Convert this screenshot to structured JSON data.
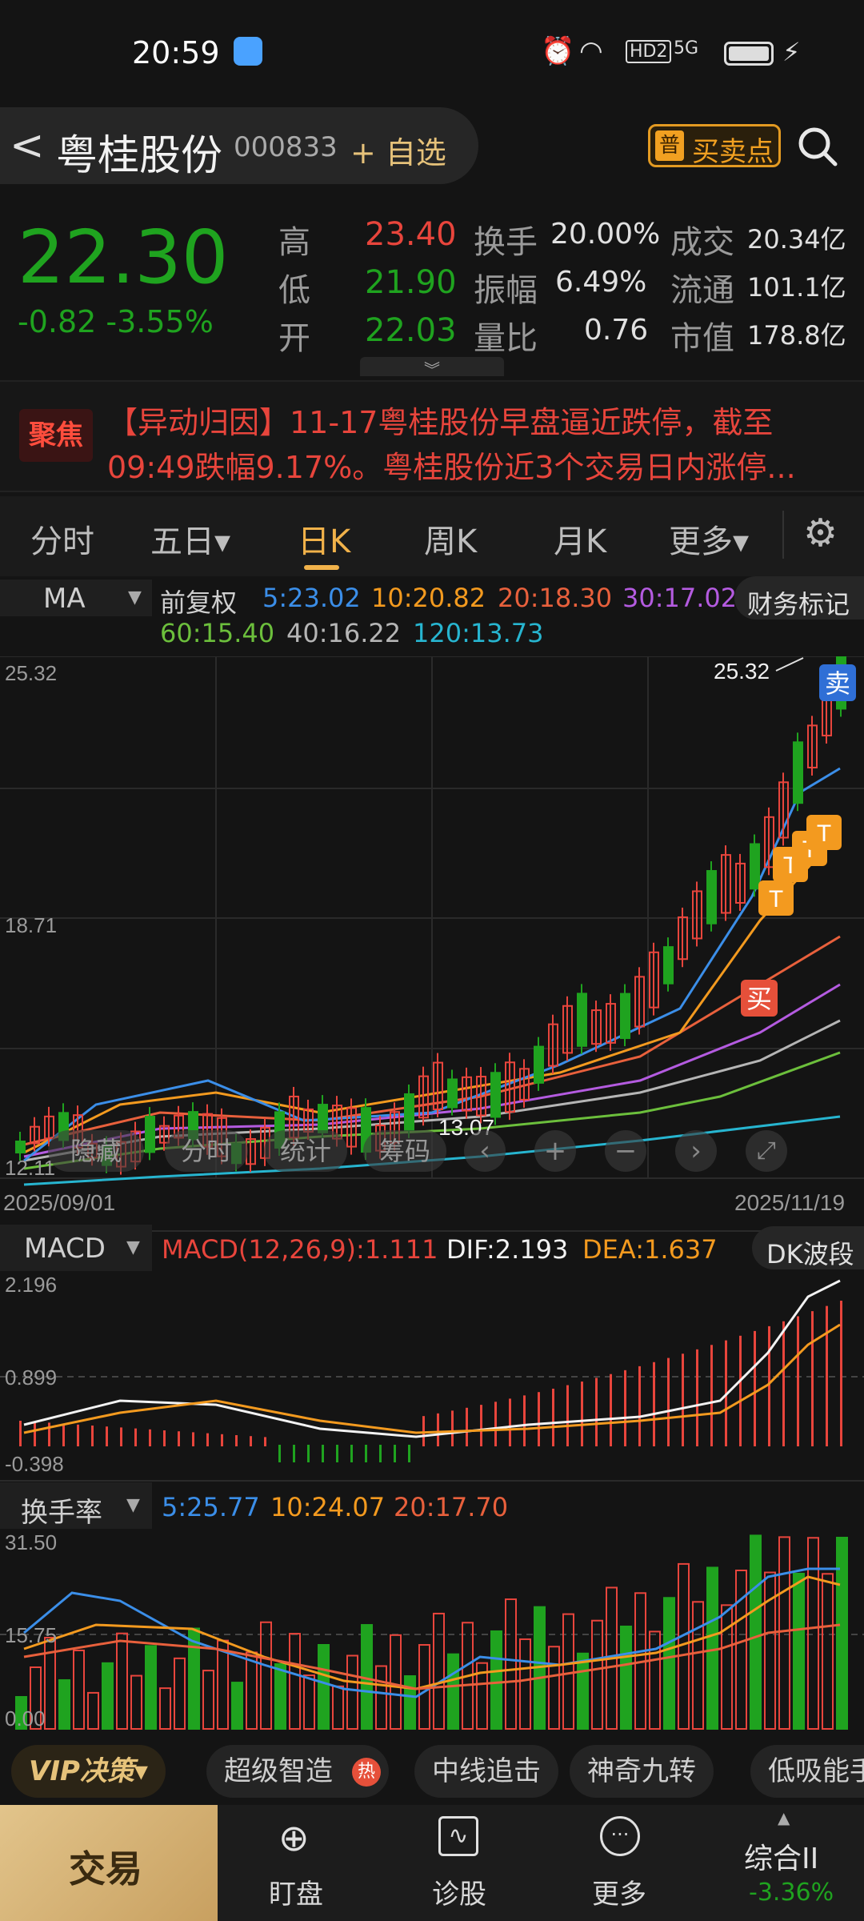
{
  "status": {
    "time": "20:59",
    "network": "5G",
    "hd": "HD2"
  },
  "header": {
    "back": "<",
    "name": "粤桂股份",
    "code": "000833",
    "add_watch": "+ 自选",
    "buy_sell_badge": "买卖点",
    "badge_icon": "普"
  },
  "quote": {
    "price": "22.30",
    "change": "-0.82 -3.55%",
    "fields": [
      {
        "label": "高",
        "value": "23.40"
      },
      {
        "label": "低",
        "value": "21.90"
      },
      {
        "label": "开",
        "value": "22.03"
      },
      {
        "label": "换手",
        "value": "20.00%"
      },
      {
        "label": "振幅",
        "value": "6.49%"
      },
      {
        "label": "量比",
        "value": "0.76"
      },
      {
        "label": "成交",
        "value": "20.34亿"
      },
      {
        "label": "流通",
        "value": "101.1亿"
      },
      {
        "label": "市值",
        "value": "178.8亿"
      }
    ]
  },
  "news": {
    "badge": "聚焦",
    "line1": "【异动归因】11-17粤桂股份早盘逼近跌停，截至",
    "line2": "09:49跌幅9.17%。粤桂股份近3个交易日内涨停..."
  },
  "tabs": [
    "分时",
    "五日▾",
    "日K",
    "周K",
    "月K",
    "更多▾"
  ],
  "ma": {
    "selector": "MA",
    "adjust": "前复权",
    "ma5": "5:23.02",
    "ma10": "10:20.82",
    "ma20": "20:18.30",
    "ma30": "30:17.02",
    "ma60": "60:15.40",
    "ma40": "40:16.22",
    "ma120": "120:13.73",
    "finance_tag": "财务标记"
  },
  "kchart": {
    "y_top": "25.32",
    "y_mid": "18.71",
    "y_bottom": "12.11",
    "high_label": "25.32",
    "low_label": "13.07",
    "date_start": "2025/09/01",
    "date_end": "2025/11/19",
    "sell": "卖",
    "buy": "买",
    "t": "T",
    "controls": [
      "隐藏",
      "分时",
      "统计",
      "筹码"
    ]
  },
  "macd": {
    "name": "MACD",
    "params": "MACD(12,26,9):1.111",
    "dif": "DIF:2.193",
    "dea": "DEA:1.637",
    "dk": "DK波段",
    "y_top": "2.196",
    "y_mid": "0.899",
    "y_bottom": "-0.398"
  },
  "turnover": {
    "name": "换手率",
    "t5": "5:25.77",
    "t10": "10:24.07",
    "t20": "20:17.70",
    "y_top": "31.50",
    "y_mid": "15.75",
    "y_bottom": "0.00"
  },
  "tags": [
    "VIP决策▾",
    "超级智造",
    "中线追击",
    "神奇九转",
    "低吸能手"
  ],
  "hot": "热",
  "nav": {
    "trade": "交易",
    "watch": "盯盘",
    "diag": "诊股",
    "more": "更多",
    "index_name": "综合II",
    "index_change": "-3.36%"
  },
  "colors": {
    "red": "#e8453c",
    "green": "#1fa31f",
    "ma5": "#3b8ee8",
    "ma10": "#f39a1f",
    "ma20": "#e8603c",
    "ma30": "#b45be0",
    "ma60": "#6cbf3c",
    "ma120": "#27b5d0"
  }
}
